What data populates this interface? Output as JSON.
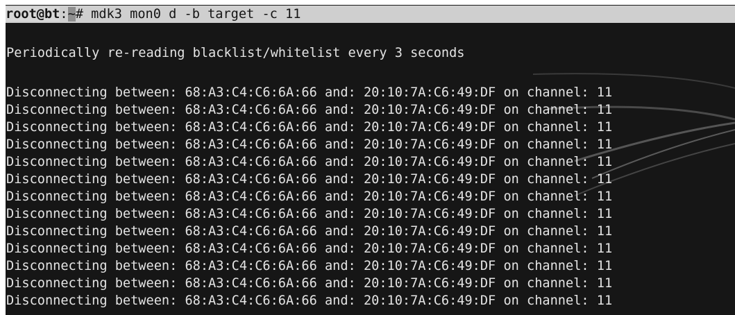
{
  "terminal": {
    "prompt_user_host": "root@bt",
    "prompt_sep": ":",
    "prompt_path": "~",
    "prompt_symbol": "# ",
    "command": "mdk3 mon0 d -b target -c 11",
    "info_line": "Periodically re-reading blacklist/whitelist every 3 seconds",
    "output_lines": [
      "Disconnecting between: 68:A3:C4:C6:6A:66 and: 20:10:7A:C6:49:DF on channel: 11",
      "Disconnecting between: 68:A3:C4:C6:6A:66 and: 20:10:7A:C6:49:DF on channel: 11",
      "Disconnecting between: 68:A3:C4:C6:6A:66 and: 20:10:7A:C6:49:DF on channel: 11",
      "Disconnecting between: 68:A3:C4:C6:6A:66 and: 20:10:7A:C6:49:DF on channel: 11",
      "Disconnecting between: 68:A3:C4:C6:6A:66 and: 20:10:7A:C6:49:DF on channel: 11",
      "Disconnecting between: 68:A3:C4:C6:6A:66 and: 20:10:7A:C6:49:DF on channel: 11",
      "Disconnecting between: 68:A3:C4:C6:6A:66 and: 20:10:7A:C6:49:DF on channel: 11",
      "Disconnecting between: 68:A3:C4:C6:6A:66 and: 20:10:7A:C6:49:DF on channel: 11",
      "Disconnecting between: 68:A3:C4:C6:6A:66 and: 20:10:7A:C6:49:DF on channel: 11",
      "Disconnecting between: 68:A3:C4:C6:6A:66 and: 20:10:7A:C6:49:DF on channel: 11",
      "Disconnecting between: 68:A3:C4:C6:6A:66 and: 20:10:7A:C6:49:DF on channel: 11",
      "Disconnecting between: 68:A3:C4:C6:6A:66 and: 20:10:7A:C6:49:DF on channel: 11",
      "Disconnecting between: 68:A3:C4:C6:6A:66 and: 20:10:7A:C6:49:DF on channel: 11"
    ]
  },
  "colors": {
    "background": "#161616",
    "text": "#e4e4e4",
    "prompt_highlight": "#cfcfcf"
  }
}
